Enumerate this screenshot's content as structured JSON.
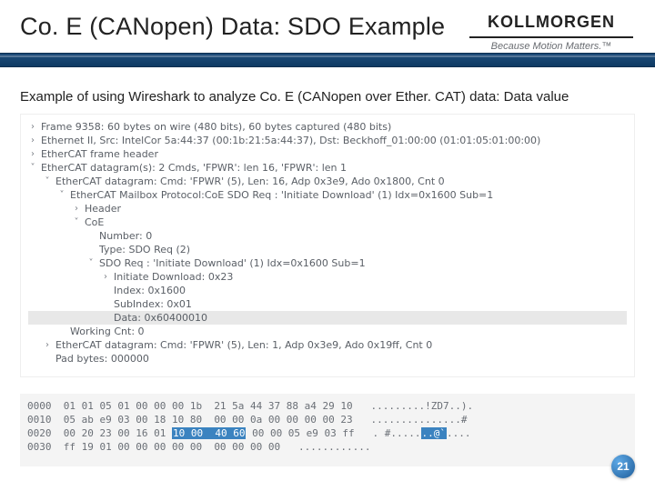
{
  "header": {
    "title": "Co. E (CANopen) Data: SDO Example",
    "brand_name": "KOLLMORGEN",
    "brand_tag": "Because Motion Matters.™"
  },
  "lead": "Example of using Wireshark to analyze Co. E (CANopen over Ether. CAT) data: Data value",
  "tree": [
    {
      "indent": 0,
      "caret": ">",
      "text": "Frame 9358: 60 bytes on wire (480 bits), 60 bytes captured (480 bits)"
    },
    {
      "indent": 0,
      "caret": ">",
      "text": "Ethernet II, Src: IntelCor 5a:44:37 (00:1b:21:5a:44:37), Dst: Beckhoff_01:00:00 (01:01:05:01:00:00)"
    },
    {
      "indent": 0,
      "caret": ">",
      "text": "EtherCAT frame header"
    },
    {
      "indent": 0,
      "caret": "v",
      "text": "EtherCAT datagram(s): 2 Cmds, 'FPWR': len 16, 'FPWR': len 1"
    },
    {
      "indent": 1,
      "caret": "v",
      "text": "EtherCAT datagram: Cmd: 'FPWR' (5), Len: 16, Adp 0x3e9, Ado 0x1800, Cnt 0"
    },
    {
      "indent": 2,
      "caret": "v",
      "text": "EtherCAT Mailbox Protocol:CoE SDO Req : 'Initiate Download' (1) Idx=0x1600 Sub=1"
    },
    {
      "indent": 3,
      "caret": ">",
      "text": "Header"
    },
    {
      "indent": 3,
      "caret": "v",
      "text": "CoE"
    },
    {
      "indent": 4,
      "caret": "",
      "text": "Number: 0"
    },
    {
      "indent": 4,
      "caret": "",
      "text": "Type: SDO Req (2)"
    },
    {
      "indent": 4,
      "caret": "v",
      "text": "SDO Req : 'Initiate Download' (1) Idx=0x1600 Sub=1"
    },
    {
      "indent": 5,
      "caret": ">",
      "text": "Initiate Download: 0x23"
    },
    {
      "indent": 5,
      "caret": "",
      "text": "Index: 0x1600"
    },
    {
      "indent": 5,
      "caret": "",
      "text": "SubIndex: 0x01"
    },
    {
      "indent": 5,
      "caret": "",
      "text": "Data: 0x60400010",
      "highlight": true
    },
    {
      "indent": 2,
      "caret": "",
      "text": "Working Cnt: 0"
    },
    {
      "indent": 1,
      "caret": ">",
      "text": "EtherCAT datagram: Cmd: 'FPWR' (5), Len: 1, Adp 0x3e9, Ado 0x19ff, Cnt 0"
    },
    {
      "indent": 1,
      "caret": "",
      "text": "Pad bytes: 000000"
    }
  ],
  "hex": [
    {
      "off": "0000",
      "b": "01 01 05 01 00 00 00 1b  21 5a 44 37 88 a4 29 10",
      "a": ".........!ZD7..)."
    },
    {
      "off": "0010",
      "b": "05 ab e9 03 00 18 10 80  00 00 0a 00 00 00 00 23",
      "a": "...............#"
    },
    {
      "off": "0020",
      "b": "00 20 23 00 16 01",
      "hl": "10 00  40 60",
      "b2": "00 00 05 e9 03 ff",
      "a": ". #.....",
      "ahl": "..@`",
      "a2": "...."
    },
    {
      "off": "0030",
      "b": "ff 19 01 00 00 00 00 00  00 00 00 00",
      "a": "............"
    }
  ],
  "page": "21"
}
